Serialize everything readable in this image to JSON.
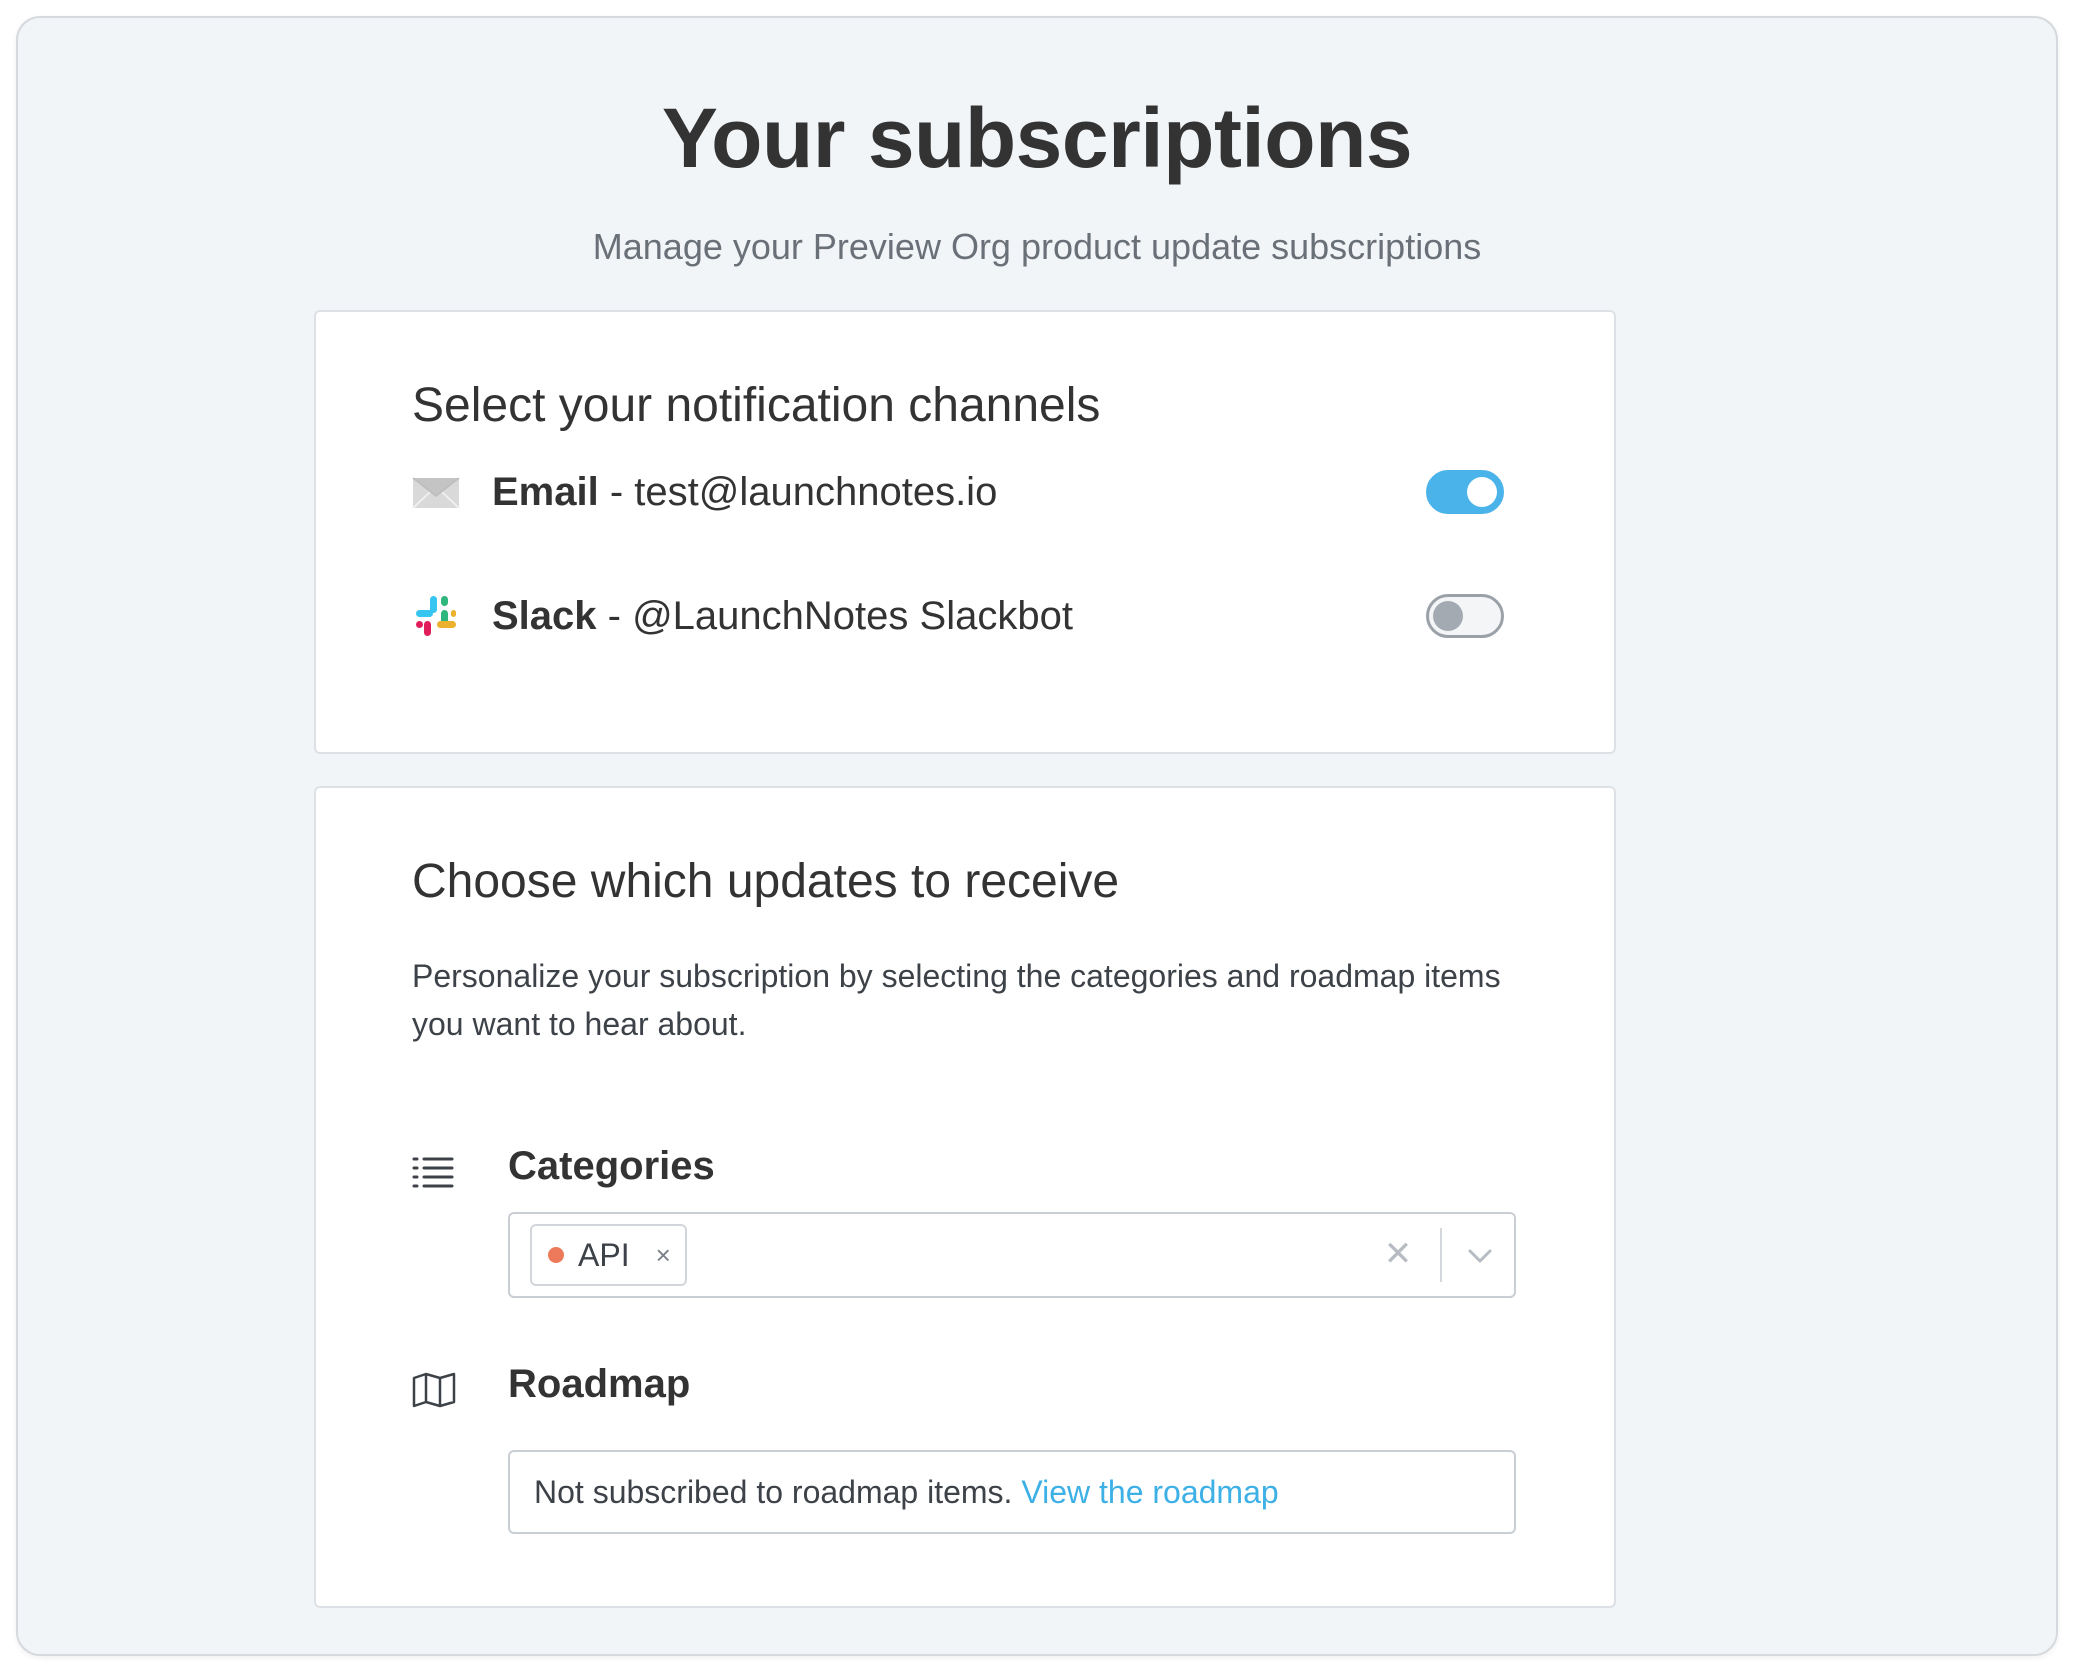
{
  "page": {
    "title": "Your subscriptions",
    "subtitle": "Manage your Preview Org product update subscriptions"
  },
  "channels": {
    "heading": "Select your notification channels",
    "email": {
      "name": "Email",
      "separator": " - ",
      "value": "test@launchnotes.io",
      "enabled": true,
      "icon": "envelope-icon"
    },
    "slack": {
      "name": "Slack",
      "separator": " - ",
      "value": "@LaunchNotes Slackbot",
      "enabled": false,
      "icon": "slack-icon"
    }
  },
  "updates": {
    "heading": "Choose which updates to receive",
    "description": "Personalize your subscription by selecting the categories and roadmap items you want to hear about.",
    "categories": {
      "label": "Categories",
      "icon": "list-icon",
      "selected": [
        {
          "label": "API",
          "color": "#ec7a5a",
          "remove_glyph": "×"
        }
      ],
      "clear_glyph": "✕"
    },
    "roadmap": {
      "label": "Roadmap",
      "icon": "map-icon",
      "status_text": "Not subscribed to roadmap items.",
      "link_text": "View the roadmap"
    }
  },
  "colors": {
    "accent": "#4ab3ea",
    "link": "#3db0e6",
    "background": "#f2f5f8"
  }
}
